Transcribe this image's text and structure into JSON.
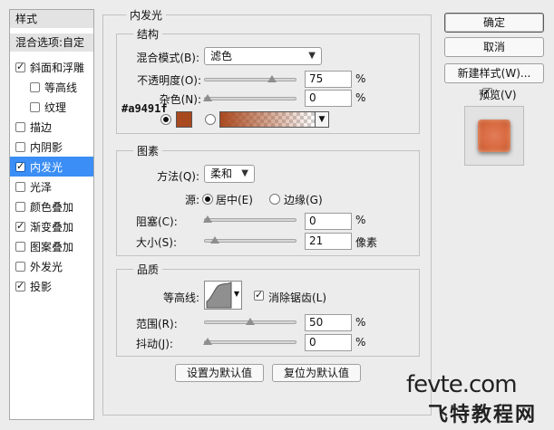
{
  "sidebar": {
    "header": "样式",
    "blend_options": "混合选项:自定",
    "items": [
      {
        "label": "斜面和浮雕",
        "checked": true,
        "indent": false,
        "selected": false
      },
      {
        "label": "等高线",
        "checked": false,
        "indent": true,
        "selected": false
      },
      {
        "label": "纹理",
        "checked": false,
        "indent": true,
        "selected": false
      },
      {
        "label": "描边",
        "checked": false,
        "indent": false,
        "selected": false
      },
      {
        "label": "内阴影",
        "checked": false,
        "indent": false,
        "selected": false
      },
      {
        "label": "内发光",
        "checked": true,
        "indent": false,
        "selected": true
      },
      {
        "label": "光泽",
        "checked": false,
        "indent": false,
        "selected": false
      },
      {
        "label": "颜色叠加",
        "checked": false,
        "indent": false,
        "selected": false
      },
      {
        "label": "渐变叠加",
        "checked": true,
        "indent": false,
        "selected": false
      },
      {
        "label": "图案叠加",
        "checked": false,
        "indent": false,
        "selected": false
      },
      {
        "label": "外发光",
        "checked": false,
        "indent": false,
        "selected": false
      },
      {
        "label": "投影",
        "checked": true,
        "indent": false,
        "selected": false
      }
    ]
  },
  "panel": {
    "title": "内发光",
    "structure": {
      "title": "结构",
      "blend_mode_label": "混合模式(B):",
      "blend_mode_value": "滤色",
      "opacity_label": "不透明度(O):",
      "opacity_value": "75",
      "opacity_level": 0.75,
      "noise_label": "杂色(N):",
      "noise_value": "0",
      "noise_level": 0,
      "unit": "%",
      "color_hex": "#a9491f",
      "color": "#a9491f"
    },
    "elements": {
      "title": "图素",
      "method_label": "方法(Q):",
      "method_value": "柔和",
      "source_label": "源:",
      "source_center": "居中(E)",
      "source_edge": "边缘(G)",
      "choke_label": "阻塞(C):",
      "choke_value": "0",
      "choke_level": 0,
      "size_label": "大小(S):",
      "size_value": "21",
      "size_unit": "像素",
      "size_level": 0.084,
      "unit": "%"
    },
    "quality": {
      "title": "品质",
      "contour_label": "等高线:",
      "antialias_label": "消除锯齿(L)",
      "range_label": "范围(R):",
      "range_value": "50",
      "range_level": 0.5,
      "jitter_label": "抖动(J):",
      "jitter_value": "0",
      "jitter_level": 0,
      "unit": "%"
    },
    "set_default": "设置为默认值",
    "reset_default": "复位为默认值"
  },
  "right": {
    "ok": "确定",
    "cancel": "取消",
    "new_style": "新建样式(W)...",
    "preview_label": "预览(V)"
  },
  "watermark": {
    "site": "fevte.com",
    "name": "飞特教程网"
  }
}
